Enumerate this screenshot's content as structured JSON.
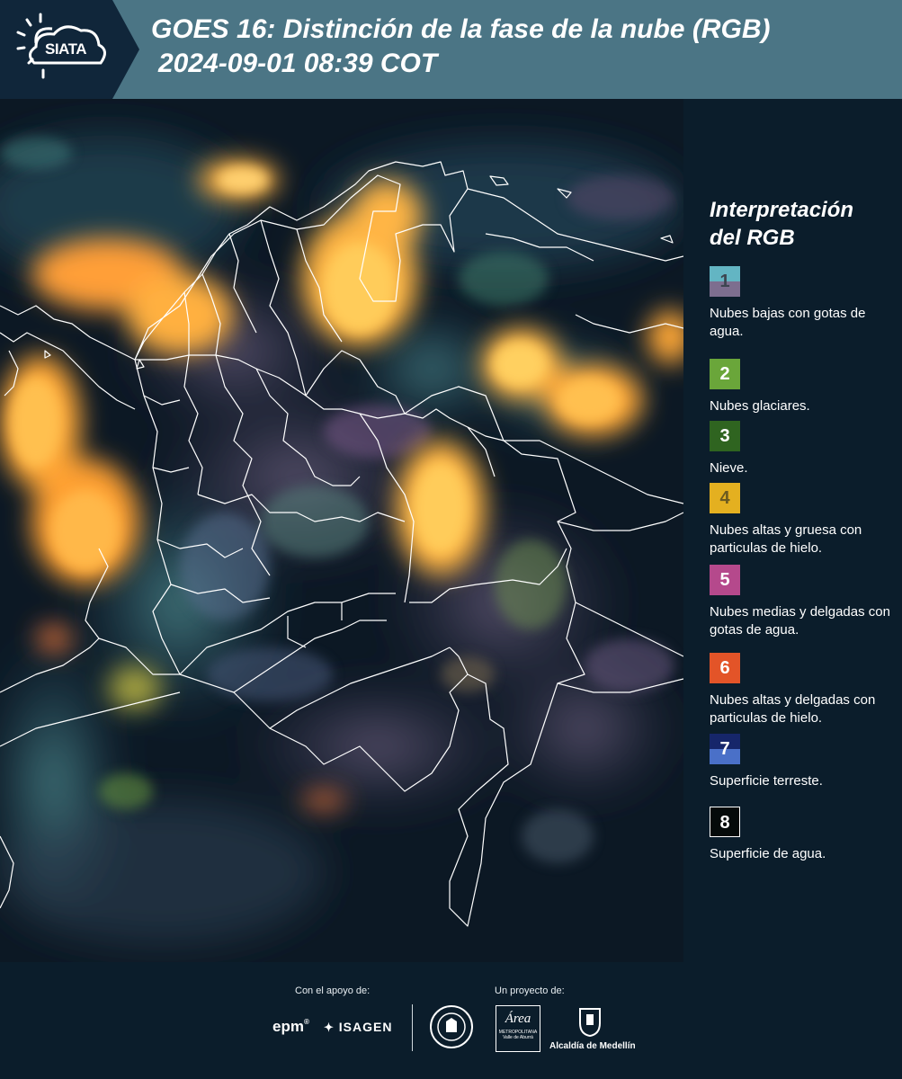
{
  "header": {
    "logo_text": "SIATA",
    "title_line1": "GOES 16: Distinción de la fase de la nube (RGB)",
    "title_line2": "2024-09-01 08:39 COT"
  },
  "legend": {
    "title": "Interpretación del RGB",
    "items": [
      {
        "number": "1",
        "label": "Nubes bajas con gotas de agua.",
        "colors": [
          "#63b5c3",
          "#7d6e8f"
        ],
        "text_color": "#3d4550"
      },
      {
        "number": "2",
        "label": "Nubes glaciares.",
        "colors": [
          "#6aa63a"
        ],
        "text_color": "#ffffff"
      },
      {
        "number": "3",
        "label": "Nieve.",
        "colors": [
          "#2f6420"
        ],
        "text_color": "#ffffff"
      },
      {
        "number": "4",
        "label": "Nubes altas y gruesa con particulas de hielo.",
        "colors": [
          "#e4b020"
        ],
        "text_color": "#6b5a20"
      },
      {
        "number": "5",
        "label": "Nubes medias y delgadas con gotas de agua.",
        "colors": [
          "#b5498c"
        ],
        "text_color": "#ffffff"
      },
      {
        "number": "6",
        "label": "Nubes altas y delgadas con particulas de hielo.",
        "colors": [
          "#e35428"
        ],
        "text_color": "#ffffff"
      },
      {
        "number": "7",
        "label": "Superficie terreste.",
        "colors": [
          "#16266a",
          "#4a70c8"
        ],
        "text_color": "#ffffff"
      },
      {
        "number": "8",
        "label": "Superficie de agua.",
        "colors": [
          "#050a0a"
        ],
        "text_color": "#ffffff"
      }
    ]
  },
  "footer": {
    "support_label": "Con el apoyo de:",
    "project_label": "Un proyecto de:",
    "epm_text": "epm",
    "isagen_text": "ISAGEN",
    "area_text": "Área",
    "area_sub": "METROPOLITANA",
    "area_sub2": "Valle de Aburrá",
    "alcaldia_text": "Alcaldía de Medellín"
  }
}
